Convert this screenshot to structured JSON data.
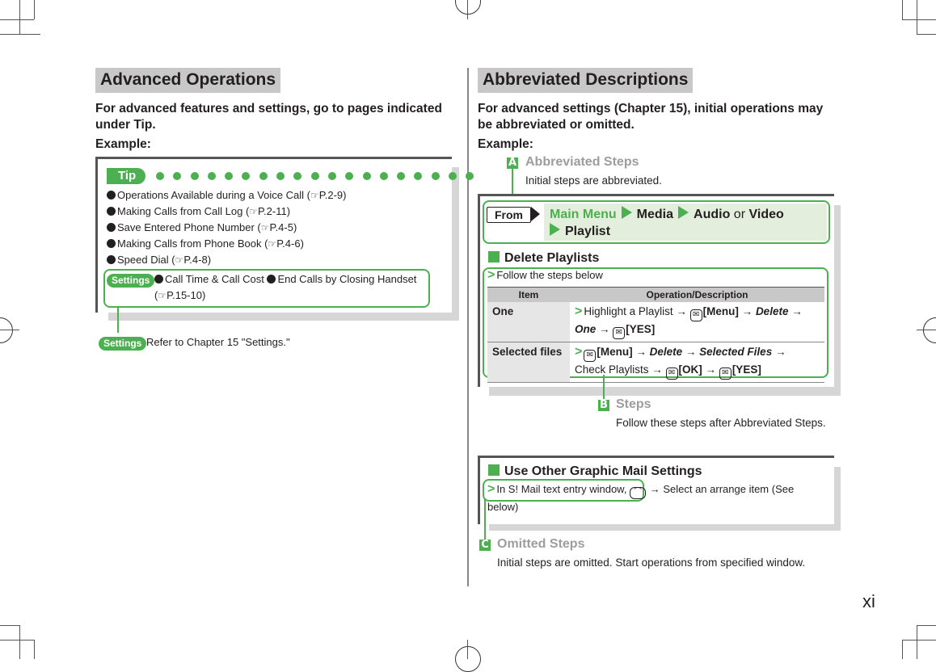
{
  "page_number": "xi",
  "left": {
    "title": "Advanced Operations",
    "lead": "For advanced features and settings, go to pages indicated under Tip.",
    "example_label": "Example:",
    "tip": {
      "label": "Tip",
      "items": [
        {
          "text": "Operations Available during a Voice Call (",
          "ref": "P.2-9",
          "close": ")"
        },
        {
          "text": "Making Calls from Call Log (",
          "ref": "P.2-11",
          "close": ")"
        },
        {
          "text": "Save Entered Phone Number (",
          "ref": "P.4-5",
          "close": ")"
        },
        {
          "text": "Making Calls from Phone Book (",
          "ref": "P.4-6",
          "close": ")"
        },
        {
          "text": "Speed Dial (",
          "ref": "P.4-8",
          "close": ")"
        }
      ],
      "settings": {
        "label": "Settings",
        "item1": "Call Time & Call Cost",
        "item2": "End Calls by Closing Handset",
        "ref_open": "(",
        "ref": "P.15-10",
        "ref_close": ")"
      }
    },
    "settings_note": {
      "label": "Settings",
      "text": "Refer to Chapter 15 \"Settings.\""
    }
  },
  "right": {
    "title": "Abbreviated Descriptions",
    "lead": "For advanced settings (Chapter 15), initial operations may be abbreviated or omitted.",
    "example_label": "Example:",
    "callouts": {
      "a": {
        "letter": "A",
        "title": "Abbreviated Steps",
        "desc": "Initial steps are abbreviated."
      },
      "b": {
        "letter": "B",
        "title": "Steps",
        "desc": "Follow these steps after Abbreviated Steps."
      },
      "c": {
        "letter": "C",
        "title": "Omitted Steps",
        "desc": "Initial steps are omitted. Start operations from specified window."
      }
    },
    "from": {
      "label": "From",
      "path": [
        "Main Menu",
        "Media",
        "Audio",
        "or",
        "Video",
        "Playlist"
      ]
    },
    "delete_playlists": {
      "heading": "Delete Playlists",
      "follow": "Follow the steps below",
      "table": {
        "headers": [
          "Item",
          "Operation/Description"
        ],
        "rows": [
          {
            "item": "One",
            "parts": [
              "Highlight a Playlist",
              "[Menu]",
              "Delete",
              "One",
              "[YES]"
            ]
          },
          {
            "item": "Selected files",
            "parts": [
              "[Menu]",
              "Delete",
              "Selected Files",
              "Check Playlists",
              "[OK]",
              "[YES]"
            ]
          }
        ]
      }
    },
    "graphic_mail": {
      "heading": "Use Other Graphic Mail Settings",
      "step_start": "In S! Mail text entry window,",
      "step_end": "Select an arrange item (See below)"
    }
  }
}
